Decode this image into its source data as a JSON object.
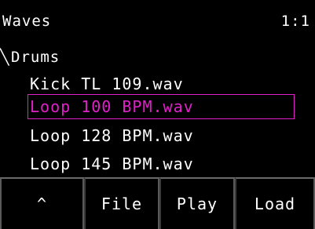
{
  "header": {
    "title": "Waves",
    "page_indicator": "1:1"
  },
  "folder": {
    "icon": "folder-open-icon",
    "label": "Drums"
  },
  "files": [
    {
      "name": "Kick TL 109.wav",
      "selected": false
    },
    {
      "name": "Loop 100 BPM.wav",
      "selected": true
    },
    {
      "name": "Loop 128 BPM.wav",
      "selected": false
    },
    {
      "name": "Loop 145 BPM.wav",
      "selected": false
    }
  ],
  "softkeys": {
    "up": "^",
    "file": "File",
    "play": "Play",
    "load": "Load"
  },
  "colors": {
    "background": "#000000",
    "text": "#ffffff",
    "selection": "#e020c8",
    "softkey_border": "#5a5a5a"
  }
}
